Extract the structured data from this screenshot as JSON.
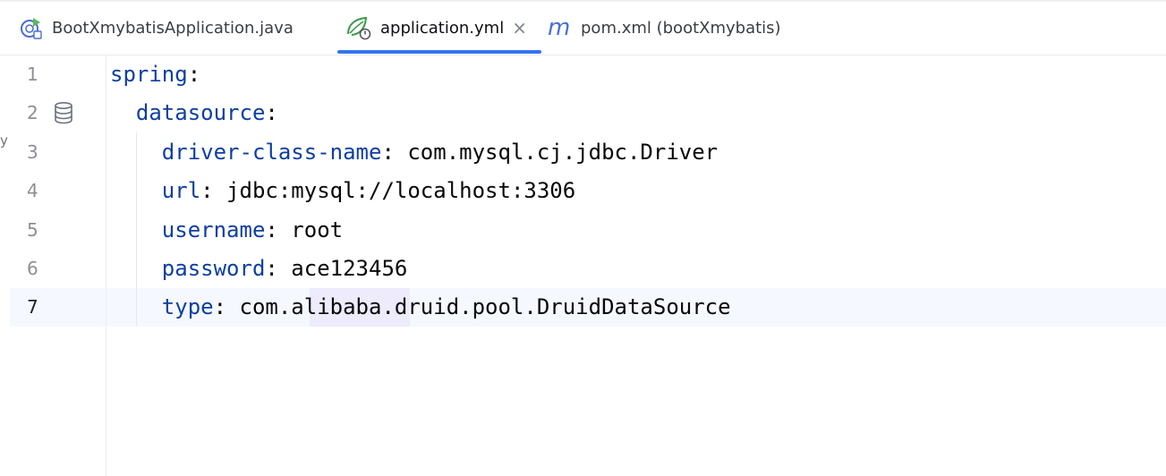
{
  "tabs": [
    {
      "label": "BootXmybatisApplication.java",
      "icon": "spring-boot-app-icon",
      "active": false
    },
    {
      "label": "application.yml",
      "icon": "spring-yaml-icon",
      "active": true,
      "closable": true,
      "close_glyph": "×"
    },
    {
      "label": "pom.xml (bootXmybatis)",
      "icon": "maven-icon",
      "active": false
    }
  ],
  "editor": {
    "current_line": 7,
    "left_edge_text": "y",
    "lines": [
      {
        "num": "1",
        "indent": "",
        "key": "spring",
        "sep": ":",
        "value": ""
      },
      {
        "num": "2",
        "indent": "  ",
        "key": "datasource",
        "sep": ":",
        "value": ""
      },
      {
        "num": "3",
        "indent": "    ",
        "key": "driver-class-name",
        "sep": ": ",
        "value": "com.mysql.cj.jdbc.Driver"
      },
      {
        "num": "4",
        "indent": "    ",
        "key": "url",
        "sep": ": ",
        "value": "jdbc:mysql://localhost:3306"
      },
      {
        "num": "5",
        "indent": "    ",
        "key": "username",
        "sep": ": ",
        "value": "root"
      },
      {
        "num": "6",
        "indent": "    ",
        "key": "password",
        "sep": ": ",
        "value": "ace123456"
      },
      {
        "num": "7",
        "indent": "    ",
        "key": "type",
        "sep": ": ",
        "value": "com.alibaba.druid.pool.DruidDataSource"
      }
    ]
  },
  "colors": {
    "accent": "#3574f0",
    "key": "#0d3fa0",
    "current_line": "#f5f8fe",
    "word_highlight": "#edebfc"
  }
}
